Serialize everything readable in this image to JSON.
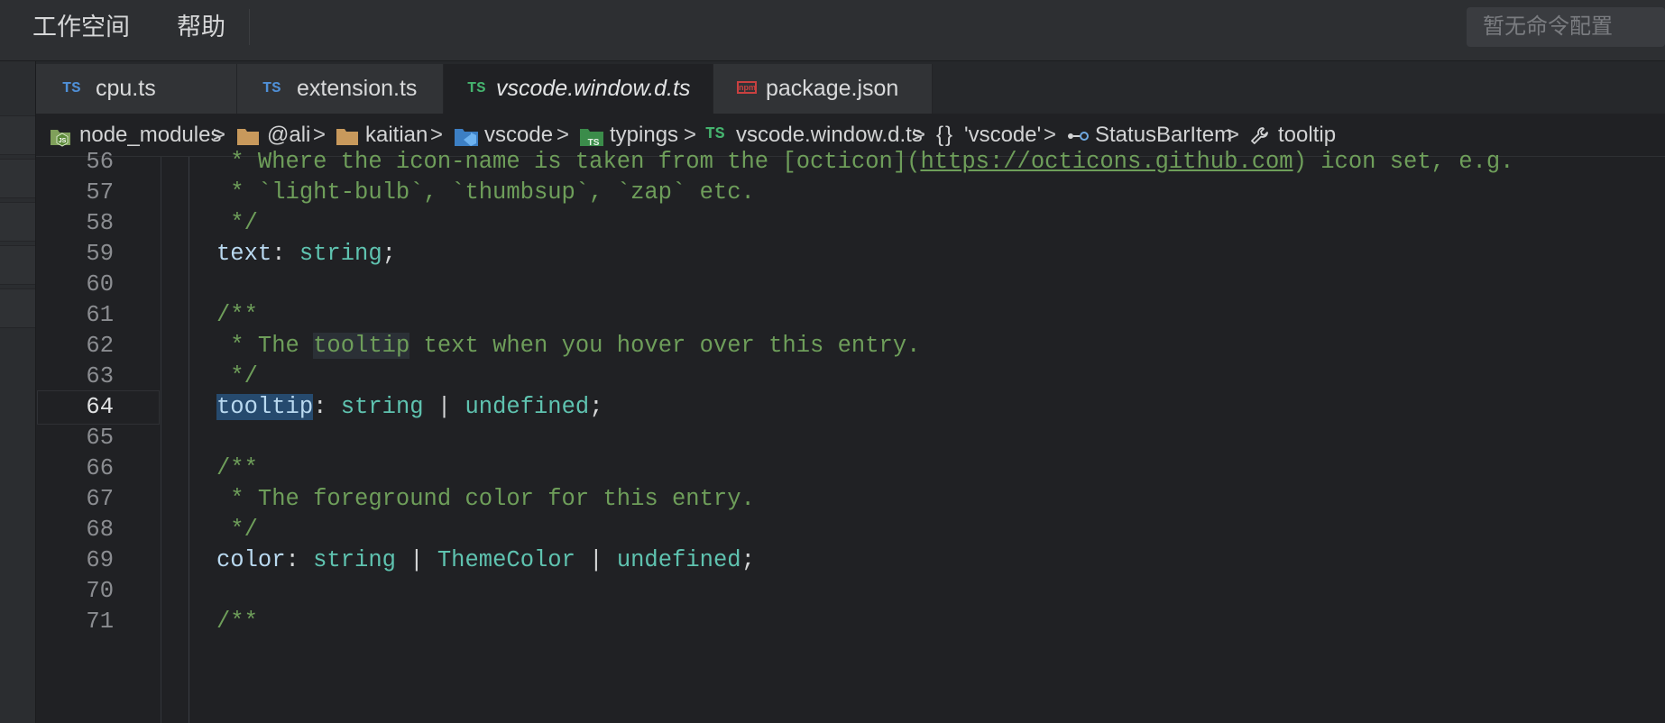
{
  "menu": {
    "workspace": "工作空间",
    "help": "帮助"
  },
  "command_placeholder": "暂无命令配置",
  "tabs": [
    {
      "icon": "TS",
      "label": "cpu.ts",
      "active": false
    },
    {
      "icon": "TS",
      "label": "extension.ts",
      "active": false
    },
    {
      "icon": "TS",
      "label": "vscode.window.d.ts",
      "active": true
    },
    {
      "icon": "npm",
      "label": "package.json",
      "active": false
    }
  ],
  "breadcrumbs": [
    {
      "icon": "node-js-folder-icon",
      "label": "node_modules"
    },
    {
      "icon": "folder-icon",
      "label": "@ali"
    },
    {
      "icon": "folder-icon",
      "label": "kaitian"
    },
    {
      "icon": "vscode-folder-icon",
      "label": "vscode"
    },
    {
      "icon": "typings-folder-icon",
      "label": "typings"
    },
    {
      "icon": "TS",
      "label": "vscode.window.d.ts"
    },
    {
      "icon": "{}",
      "label": "'vscode'"
    },
    {
      "icon": "interface-icon",
      "label": "StatusBarItem"
    },
    {
      "icon": "wrench-icon",
      "label": "tooltip"
    }
  ],
  "editor": {
    "current_line": 64,
    "lines": [
      {
        "n": "56",
        "tokens": [
          {
            "t": " * Where the icon-name is taken from the [octicon](",
            "c": "c"
          },
          {
            "t": "https://octicons.github.com",
            "c": "c url"
          },
          {
            "t": ") icon set, e.g.",
            "c": "c"
          }
        ]
      },
      {
        "n": "57",
        "tokens": [
          {
            "t": " * `light-bulb`, `thumbsup`, `zap` etc.",
            "c": "c"
          }
        ]
      },
      {
        "n": "58",
        "tokens": [
          {
            "t": " */",
            "c": "c"
          }
        ]
      },
      {
        "n": "59",
        "tokens": [
          {
            "t": "text",
            "c": "prop"
          },
          {
            "t": ": ",
            "c": "op"
          },
          {
            "t": "string",
            "c": "typ"
          },
          {
            "t": ";",
            "c": "op"
          }
        ]
      },
      {
        "n": "60",
        "tokens": []
      },
      {
        "n": "61",
        "tokens": [
          {
            "t": "/**",
            "c": "c"
          }
        ]
      },
      {
        "n": "62",
        "tokens": [
          {
            "t": " * The ",
            "c": "c"
          },
          {
            "t": "tooltip",
            "c": "c hl-soft"
          },
          {
            "t": " text when you hover over this entry.",
            "c": "c"
          }
        ]
      },
      {
        "n": "63",
        "tokens": [
          {
            "t": " */",
            "c": "c"
          }
        ]
      },
      {
        "n": "64",
        "tokens": [
          {
            "t": "tooltip",
            "c": "prop hl-sel"
          },
          {
            "t": ": ",
            "c": "op"
          },
          {
            "t": "string",
            "c": "typ"
          },
          {
            "t": " | ",
            "c": "op"
          },
          {
            "t": "undefined",
            "c": "typ"
          },
          {
            "t": ";",
            "c": "op"
          }
        ]
      },
      {
        "n": "65",
        "tokens": []
      },
      {
        "n": "66",
        "tokens": [
          {
            "t": "/**",
            "c": "c"
          }
        ]
      },
      {
        "n": "67",
        "tokens": [
          {
            "t": " * The foreground color for this entry.",
            "c": "c"
          }
        ]
      },
      {
        "n": "68",
        "tokens": [
          {
            "t": " */",
            "c": "c"
          }
        ]
      },
      {
        "n": "69",
        "tokens": [
          {
            "t": "color",
            "c": "prop"
          },
          {
            "t": ": ",
            "c": "op"
          },
          {
            "t": "string",
            "c": "typ"
          },
          {
            "t": " | ",
            "c": "op"
          },
          {
            "t": "ThemeColor",
            "c": "typ"
          },
          {
            "t": " | ",
            "c": "op"
          },
          {
            "t": "undefined",
            "c": "typ"
          },
          {
            "t": ";",
            "c": "op"
          }
        ]
      },
      {
        "n": "70",
        "tokens": []
      },
      {
        "n": "71",
        "tokens": [
          {
            "t": "/**",
            "c": "c"
          }
        ]
      }
    ]
  },
  "colors": {
    "background": "#202124",
    "comment": "#6e9e5a",
    "property": "#b9d9f0",
    "type": "#5fc3b0",
    "ts_icon_active": "#45b36e",
    "ts_icon": "#4f8fd6",
    "selection": "#264a6e"
  }
}
